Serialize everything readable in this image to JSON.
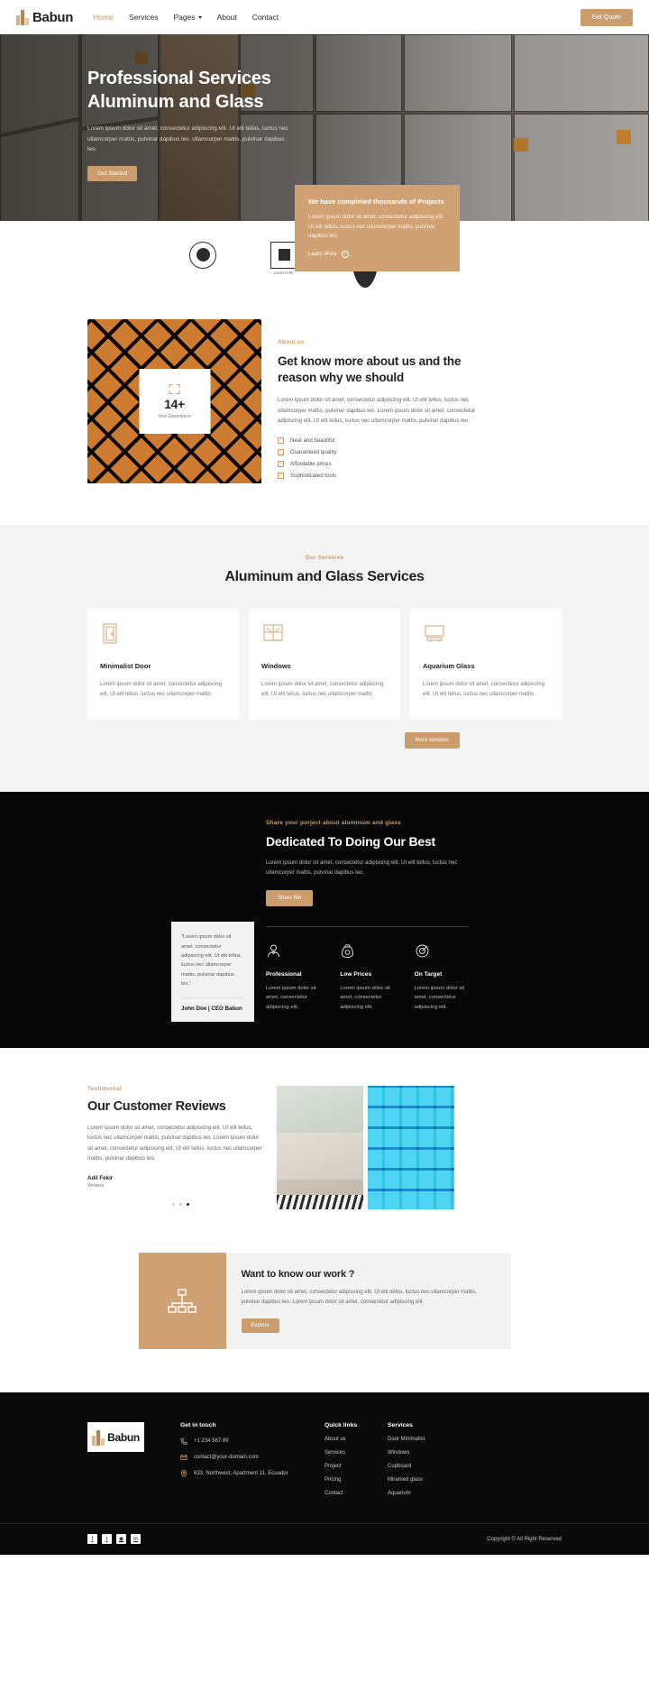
{
  "nav": {
    "brand": "Babun",
    "links": [
      {
        "label": "Home",
        "active": true
      },
      {
        "label": "Services",
        "active": false
      },
      {
        "label": "Pages",
        "active": false,
        "caret": true
      },
      {
        "label": "About",
        "active": false
      },
      {
        "label": "Contact",
        "active": false
      }
    ],
    "cta_label": "Get Quote"
  },
  "hero": {
    "title_line1": "Professional Services",
    "title_line2": "Aluminum and Glass",
    "paragraph": "Lorem ipsum dolor sit amet, consectetur adipiscing elit. Ut elit tellus, luctus nec ullamcorper mattis, pulvinar dapibus leo. ullamcorper mattis, pulvinar dapibus leo.",
    "button": "Get Started",
    "card": {
      "title": "We have completed thousands of Projects",
      "paragraph": "Lorem ipsum dolor sit amet, consectetur adipiscing elit. Ut elit tellus, luctus nec ullamcorper mattis, pulvinar dapibus leo.",
      "link": "Learn More"
    }
  },
  "logos": [
    {
      "name": "partner-logo-1",
      "caption": ""
    },
    {
      "name": "partner-logo-2",
      "caption": "LOGOTYPE"
    },
    {
      "name": "partner-logo-3",
      "caption": ""
    },
    {
      "name": "partner-logo-4",
      "caption": ""
    }
  ],
  "about": {
    "badge_number": "14+",
    "badge_label": "Year Experience",
    "eyebrow": "About us",
    "heading": "Get know more about us and the reason why we should",
    "paragraph": "Lorem ipsum dolor sit amet, consectetur adipiscing elit. Ut elit tellus, luctus nec ullamcorper mattis, pulvinar dapibus leo. Lorem ipsum dolor sit amet, consectetur adipiscing elit. Ut elit tellus, luctus nec ullamcorper mattis, pulvinar dapibus leo.",
    "checklist": [
      "Neat and beautiful",
      "Guaranteed quality",
      "Affordable prices",
      "Sophisticated tools"
    ]
  },
  "services": {
    "eyebrow": "Our Services",
    "heading": "Aluminum and Glass Services",
    "cards": [
      {
        "icon": "door-icon",
        "title": "Minimalist Door",
        "text": "Lorem ipsum dolor sit amet, consectetur adipiscing elit. Ut elit tellus, luctus nec ullamcorper mattis"
      },
      {
        "icon": "window-icon",
        "title": "Windows",
        "text": "Lorem ipsum dolor sit amet, consectetur adipiscing elit. Ut elit tellus, luctus nec ullamcorper mattis"
      },
      {
        "icon": "aquarium-icon",
        "title": "Aquarium Glass",
        "text": "Lorem ipsum dolor sit amet, consectetur adipiscing elit. Ut elit tellus, luctus nec ullamcorper mattis ."
      }
    ],
    "more_button": "More services"
  },
  "dedicated": {
    "eyebrow": "Share your porject about aluminum and glass",
    "heading": "Dedicated To Doing Our Best",
    "paragraph": "Lorem ipsum dolor sit amet, consectetur adipiscing elit. Ut elit tellus, luctus nec ullamcorper mattis, pulvinar dapibus leo.",
    "button": "Share Nw",
    "features": [
      {
        "icon": "professional-icon",
        "title": "Professional",
        "text": "Lorem ipsum dolor sit amet, consectetur adipiscing elit."
      },
      {
        "icon": "money-bag-icon",
        "title": "Low Prices",
        "text": "Lorem ipsum dolor sit amet, consectetur adipiscing elit."
      },
      {
        "icon": "target-icon",
        "title": "On Target",
        "text": "Lorem ipsum dolor sit amet, consectetur adipiscing elit."
      }
    ],
    "quote": {
      "text": "\"Lorem ipsum dolor sit amet, consectetur adipiscing elit. Ut elit tellus, luctus nec ullamcorper mattis, pulvinar dapibus leo.\"",
      "author": "John Doe | CEO Babun"
    }
  },
  "reviews": {
    "eyebrow": "Testimonial",
    "heading": "Our Customer Reviews",
    "paragraph": "Lorem ipsum dolor sit amet, consectetur adipiscing elit. Ut elit tellus, luctus nec ullamcorper mattis, pulvinar dapibus leo. Lorem ipsum dolor sit amet, consectetur adipiscing elit. Ut elit tellus, luctus nec ullamcorper mattis, pulvinar dapibus leo.",
    "author": "Adil Fekir",
    "role": "Writers",
    "dots": 3,
    "active_dot": 3
  },
  "cta": {
    "icon": "sitemap-icon",
    "heading": "Want to know our work ?",
    "paragraph": "Lorem ipsum dolor sit amet, consectetur adipiscing elit. Ut elit tellus, luctus nec ullamcorper mattis, pulvinar dapibus leo. Lorem ipsum dolor sit amet, consectetur adipiscing elit.",
    "button": "Explore"
  },
  "footer": {
    "brand": "Babun",
    "contact_heading": "Get in touch",
    "phone": "+1 234 567 89",
    "email": "contact@your-domain.com",
    "address": "633, Northwest, Apartment 11, Ecuador",
    "quick_heading": "Quick links",
    "quick_links": [
      "About us",
      "Services",
      "Project",
      "Pricing",
      "Contact"
    ],
    "services_heading": "Services",
    "services_links": [
      "Door Minimalist",
      "Windows",
      "Cupboard",
      "Miramed glass",
      "Aquarium"
    ],
    "socials": [
      "facebook-icon",
      "twitter-icon",
      "instagram-icon",
      "linkedin-icon"
    ],
    "copyright": "Copyright © All Right Reserved"
  },
  "colors": {
    "accent": "#cb9c6c",
    "accent_soft": "#cfa173",
    "dark": "#070707"
  }
}
